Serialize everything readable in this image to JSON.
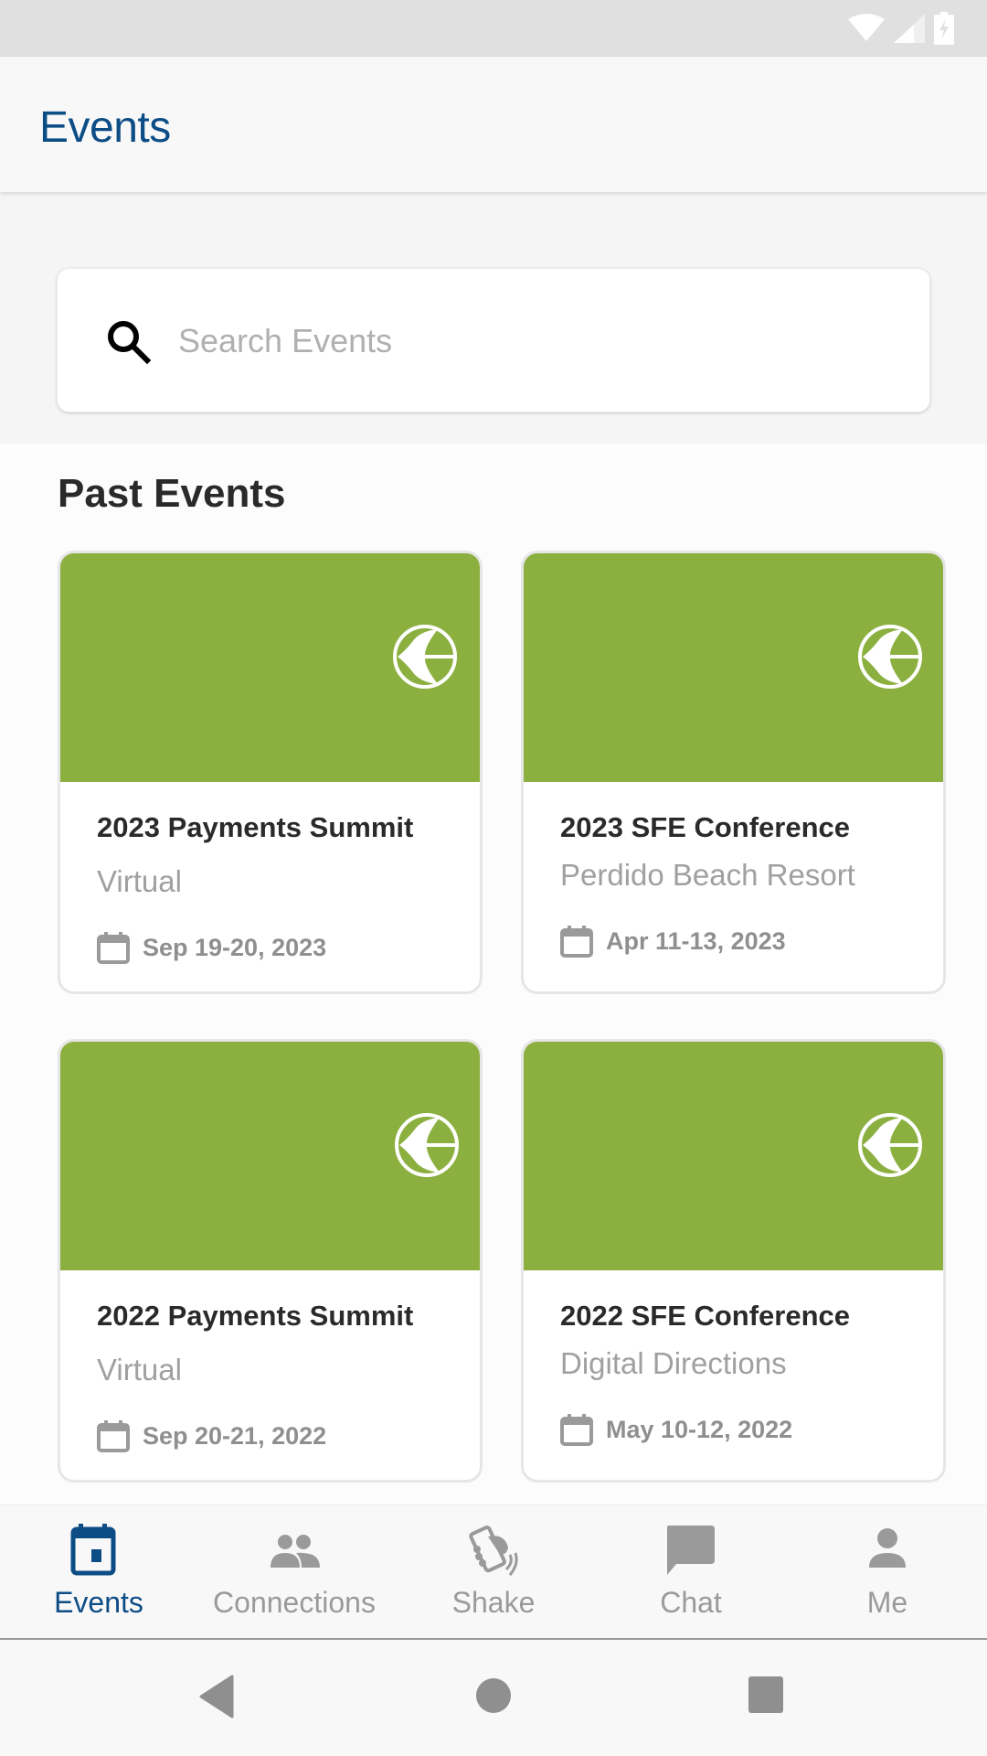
{
  "status_bar": {
    "icons": [
      "wifi-icon",
      "cellular-signal-icon",
      "battery-charging-icon"
    ]
  },
  "header": {
    "title": "Events"
  },
  "search": {
    "placeholder": "Search Events",
    "value": "",
    "icon": "search-icon"
  },
  "section": {
    "title": "Past Events"
  },
  "events": [
    {
      "title": "2023 Payments Summit",
      "location": "Virtual",
      "date": "Sep 19-20, 2023",
      "banner_color": "#8bb040"
    },
    {
      "title": "2023 SFE Conference",
      "location": "Perdido Beach Resort",
      "date": "Apr 11-13, 2023",
      "banner_color": "#8bb040"
    },
    {
      "title": "2022 Payments Summit",
      "location": "Virtual",
      "date": "Sep 20-21, 2022",
      "banner_color": "#8bb040"
    },
    {
      "title": "2022 SFE Conference",
      "location": "Digital Directions",
      "date": "May 10-12, 2022",
      "banner_color": "#8bb040"
    }
  ],
  "bottom_nav": {
    "active": "Events",
    "items": [
      {
        "label": "Events",
        "icon": "calendar-icon"
      },
      {
        "label": "Connections",
        "icon": "people-icon"
      },
      {
        "label": "Shake",
        "icon": "phone-shake-icon"
      },
      {
        "label": "Chat",
        "icon": "chat-bubble-icon"
      },
      {
        "label": "Me",
        "icon": "person-icon"
      }
    ]
  },
  "system_nav": {
    "buttons": [
      "back",
      "home",
      "recents"
    ]
  },
  "colors": {
    "brand_blue": "#0d4d86",
    "banner_green": "#8bb040",
    "inactive_gray": "#9a9a9a"
  }
}
